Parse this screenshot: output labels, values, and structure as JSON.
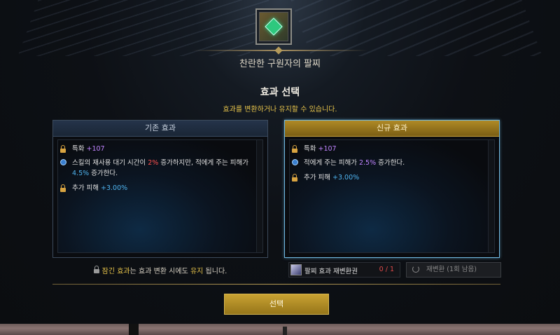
{
  "item": {
    "name": "찬란한 구원자의 팔찌",
    "icon": "bracelet-icon"
  },
  "panel": {
    "title": "효과 선택",
    "subtitle": "효과를 변환하거나 유지할 수 있습니다."
  },
  "existing": {
    "header": "기존 효과",
    "effects": [
      {
        "icon": "lock-icon",
        "text": "특화 ",
        "value": "+107"
      },
      {
        "icon": "gear-icon",
        "text_a": "스킬의 재사용 대기 시간이 ",
        "value_a": "2%",
        "text_b": " 증가하지만, 적에게 주는 피해가 ",
        "value_b": "4.5%",
        "text_c": " 증가한다."
      },
      {
        "icon": "lock-icon",
        "text": "추가 피해 ",
        "value": "+3.00%"
      }
    ]
  },
  "new": {
    "header": "신규 효과",
    "effects": [
      {
        "icon": "lock-icon",
        "text": "특화 ",
        "value": "+107"
      },
      {
        "icon": "gear-icon",
        "text_a": "적에게 주는 피해가 ",
        "value_a": "2.5%",
        "text_b": " 증가한다."
      },
      {
        "icon": "lock-icon",
        "text": "추가 피해 ",
        "value": "+3.00%"
      }
    ]
  },
  "note": {
    "a": "잠긴 효과",
    "b": "는 효과 변환 시에도 ",
    "c": "유지",
    "d": " 됩니다."
  },
  "ticket": {
    "name": "팔찌 효과 재변환권",
    "count": "0 / 1"
  },
  "reconvert": {
    "label": "재변환 (1회 남음)"
  },
  "select_button": "선택",
  "colors": {
    "gold": "#e6c34a",
    "purple": "#c084ff",
    "blue": "#4fb4f0",
    "red": "#ff5050"
  }
}
